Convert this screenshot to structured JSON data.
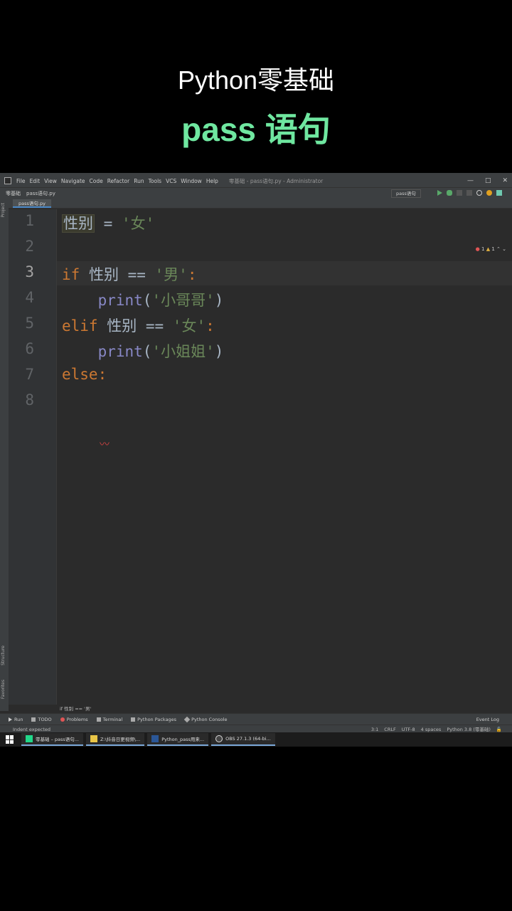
{
  "overlay": {
    "title": "Python零基础",
    "subtitle": "pass 语句"
  },
  "menu": {
    "items": [
      "File",
      "Edit",
      "View",
      "Navigate",
      "Code",
      "Refactor",
      "Run",
      "Tools",
      "VCS",
      "Window",
      "Help"
    ],
    "window_title": "零基础 - pass语句.py - Administrator"
  },
  "toolbar": {
    "project": "零基础",
    "file": "pass语句.py",
    "run_config": "pass语句"
  },
  "sidebar": {
    "project": "Project",
    "structure": "Structure",
    "favorites": "Favorites"
  },
  "tab": {
    "label": "pass语句.py"
  },
  "inspections": {
    "errors": "1",
    "warnings": "1"
  },
  "code": {
    "line_numbers": [
      "1",
      "2",
      "3",
      "4",
      "5",
      "6",
      "7",
      "8"
    ],
    "l1_var": "性别",
    "l1_op": " = ",
    "l1_str": "'女'",
    "l3_kw": "if",
    "l3_rest": " 性别 == ",
    "l3_str": "'男'",
    "l3_colon": ":",
    "l4_fn": "print",
    "l4_open": "(",
    "l4_str": "'小哥哥'",
    "l4_close": ")",
    "l5_kw": "elif",
    "l5_rest": " 性别 == ",
    "l5_str": "'女'",
    "l5_colon": ":",
    "l6_fn": "print",
    "l6_open": "(",
    "l6_str": "'小姐姐'",
    "l6_close": ")",
    "l7_kw": "else",
    "l7_colon": ":"
  },
  "breadcrumb": "if 性别 == '男'",
  "toolwindows": [
    "Run",
    "TODO",
    "Problems",
    "Terminal",
    "Python Packages",
    "Python Console"
  ],
  "event_log": "Event Log",
  "status": {
    "message": "Indent expected",
    "position": "3:1",
    "line_sep": "CRLF",
    "encoding": "UTF-8",
    "indent": "4 spaces",
    "interpreter": "Python 3.8 (零基础)"
  },
  "taskbar": {
    "tasks": [
      "零基础 – pass语句...",
      "Z:\\抖音日更视频\\...",
      "Python_pass用来...",
      "OBS 27.1.3 (64-bi..."
    ]
  },
  "colors": {
    "keyword": "#cc7832",
    "string": "#6a8759",
    "builtin": "#8888c6",
    "accent_green": "#6fe7a0"
  }
}
